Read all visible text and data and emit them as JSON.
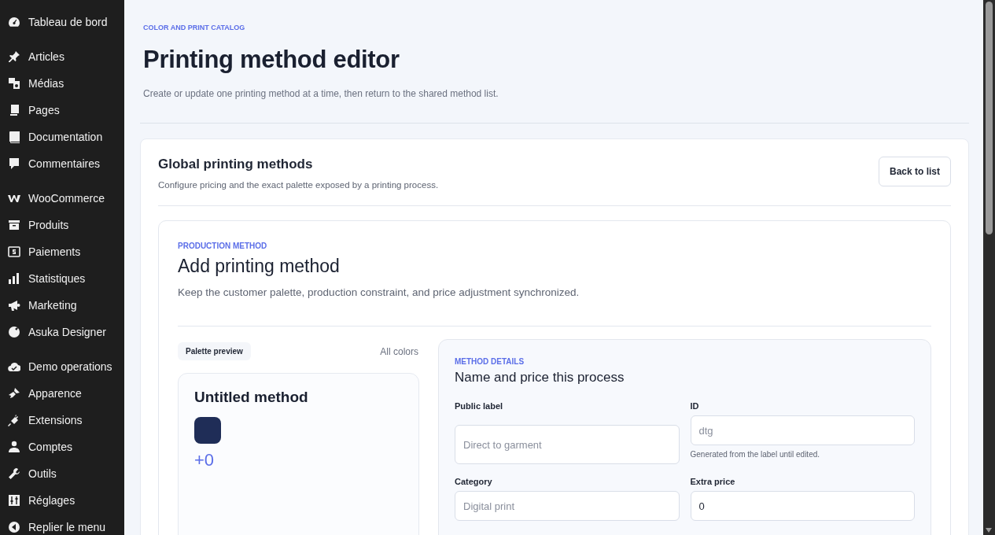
{
  "sidebar": {
    "groups": [
      {
        "items": [
          {
            "label": "Tableau de bord",
            "selected": false
          }
        ]
      },
      {
        "items": [
          {
            "label": "Articles",
            "selected": false
          },
          {
            "label": "Médias",
            "selected": false
          },
          {
            "label": "Pages",
            "selected": false
          },
          {
            "label": "Documentation",
            "selected": false
          },
          {
            "label": "Commentaires",
            "selected": false
          }
        ]
      },
      {
        "items": [
          {
            "label": "WooCommerce",
            "selected": false
          },
          {
            "label": "Produits",
            "selected": false
          },
          {
            "label": "Paiements",
            "selected": false
          },
          {
            "label": "Statistiques",
            "selected": false
          },
          {
            "label": "Marketing",
            "selected": false
          },
          {
            "label": "Asuka Designer",
            "selected": false
          }
        ]
      },
      {
        "items": [
          {
            "label": "Demo operations",
            "selected": false
          },
          {
            "label": "Apparence",
            "selected": false
          },
          {
            "label": "Extensions",
            "selected": false
          },
          {
            "label": "Comptes",
            "selected": false
          },
          {
            "label": "Outils",
            "selected": false
          },
          {
            "label": "Réglages",
            "selected": false
          },
          {
            "label": "Replier le menu",
            "selected": false
          }
        ]
      }
    ]
  },
  "header": {
    "eyebrow": "COLOR AND PRINT CATALOG",
    "title": "Printing method editor",
    "subtitle": "Create or update one printing method at a time, then return to the shared method list."
  },
  "card": {
    "title": "Global printing methods",
    "description": "Configure pricing and the exact palette exposed by a printing process.",
    "back_button": "Back to list"
  },
  "method": {
    "eyebrow": "PRODUCTION METHOD",
    "title": "Add printing method",
    "description": "Keep the customer palette, production constraint, and price adjustment synchronized.",
    "preview": {
      "tag": "Palette preview",
      "filter": "All colors",
      "name": "Untitled method",
      "swatches": [
        {
          "color": "#1f2d57"
        }
      ],
      "price": "+0"
    },
    "details": {
      "eyebrow": "METHOD DETAILS",
      "title": "Name and price this process",
      "fields": [
        {
          "label": "Public label",
          "placeholder": "Direct to garment"
        },
        {
          "label": "ID",
          "placeholder": "dtg",
          "help": "Generated from the label until edited."
        },
        {
          "label": "Category",
          "placeholder": "Digital print"
        },
        {
          "label": "Extra price",
          "value": "0"
        }
      ]
    }
  }
}
